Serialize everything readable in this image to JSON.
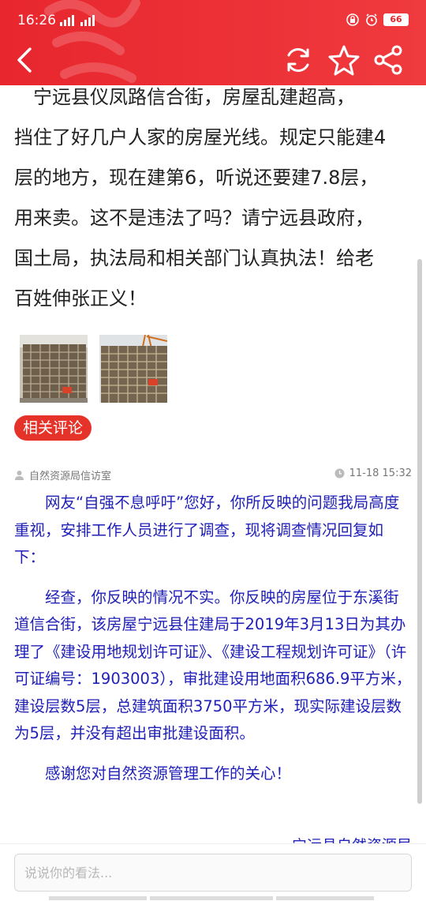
{
  "status_bar": {
    "time": "16:26",
    "network": "4G",
    "battery": "66"
  },
  "header": {
    "icons": [
      "back-arrow-icon",
      "refresh-icon",
      "star-icon",
      "share-icon"
    ],
    "background": "#e8262e"
  },
  "post": {
    "lines": [
      "　宁远县仪凤路信合街，房屋乱建超高，",
      "挡住了好几户人家的房屋光线。规定只能建4",
      "层的地方，现在建第6，听说还要建7.8层，",
      "用来卖。这不是违法了吗？请宁远县政府，",
      "国土局，执法局和相关部门认真执法！给老",
      "百姓伸张正义！"
    ]
  },
  "comments_tag": "相关评论",
  "reply": {
    "author": "自然资源局信访室",
    "time": "11-18 15:32",
    "paragraphs": [
      "网友“自强不息呼吁”您好，你所反映的问题我局高度重视，安排工作人员进行了调查，现将调查情况回复如下：",
      "经查，你反映的情况不实。你反映的房屋位于东溪街道信合街，该房屋宁远县住建局于2019年3月13日为其办理了《建设用地规划许可证》、《建设工程规划许可证》（许可证编号：1903003），审批建设用地面积686.9平方米，建设层数5层，总建筑面积3750平方米，现实际建设层数为5层，并没有超出审批建设面积。",
      "感谢您对自然资源管理工作的关心！"
    ],
    "signature": "宁远县自然资源局",
    "text_color": "#2020b8"
  },
  "bottom": {
    "placeholder": "说说你的看法..."
  }
}
